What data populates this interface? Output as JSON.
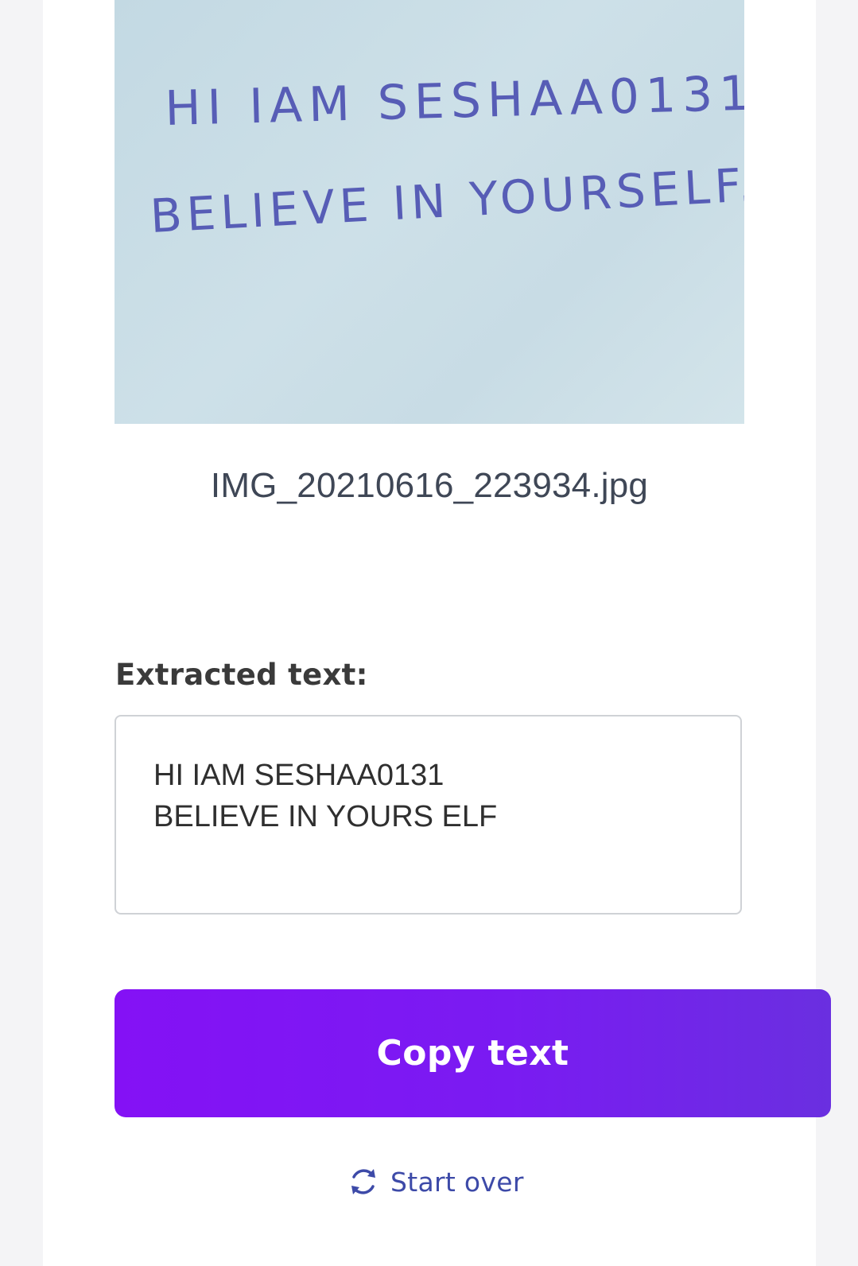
{
  "preview": {
    "handwriting_line1": "HI IAM SESHAA0131",
    "handwriting_line2": "BELIEVE IN YOURSELF."
  },
  "file": {
    "name": "IMG_20210616_223934.jpg"
  },
  "result": {
    "label": "Extracted text:",
    "text": "HI IAM SESHAA0131\nBELIEVE IN YOURS ELF"
  },
  "actions": {
    "copy_label": "Copy text",
    "start_over_label": "Start over",
    "start_over_icon": "refresh-icon"
  },
  "colors": {
    "accent": "#8411f5",
    "link": "#3d4aa8",
    "ink": "#4a4fb0"
  }
}
